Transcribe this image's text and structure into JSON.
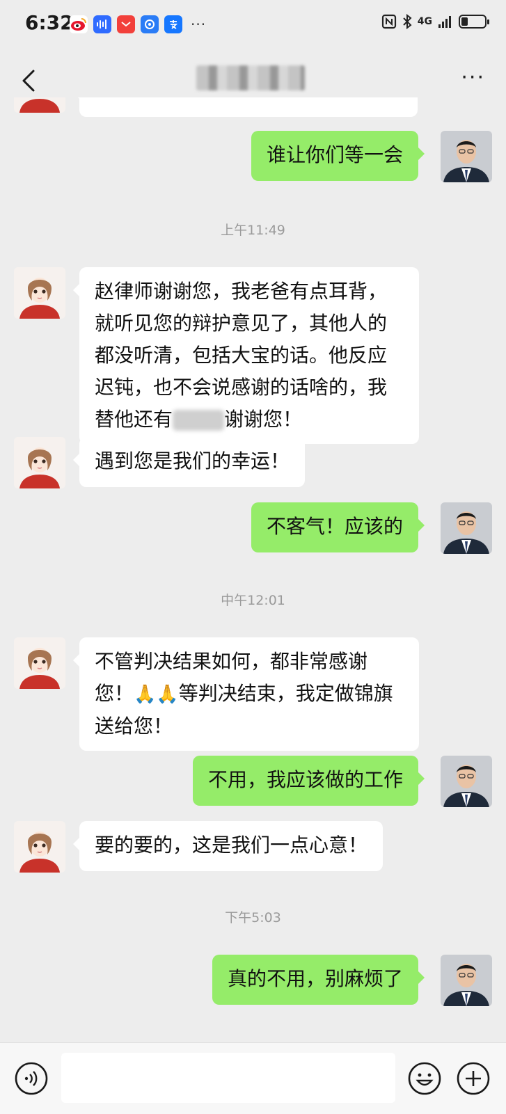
{
  "status_bar": {
    "time": "6:32",
    "network": "4G",
    "icons": [
      "weibo-icon",
      "voice-app-icon",
      "red-app-icon",
      "blue-app-icon",
      "alipay-icon",
      "more-dots-icon",
      "nfc-icon",
      "bluetooth-icon",
      "signal-icon",
      "battery-icon"
    ],
    "battery_level": 0.3
  },
  "header": {
    "back_icon": "chevron-left-icon",
    "more_label": "···"
  },
  "timestamps": {
    "t1": "上午11:49",
    "t2": "中午12:01",
    "t3": "下午5:03"
  },
  "messages": {
    "m1": "谁让你们等一会",
    "m2": "赵律师谢谢您，我老爸有点耳背，就听见您的辩护意见了，其他人的都没听清，包括大宝的话。他反应迟钝，也不会说感谢的话啥的，我替他还有",
    "m2_tail": "谢谢您！",
    "m3": "遇到您是我们的幸运！",
    "m4": "不客气！应该的",
    "m5_a": "不管判决结果如何，都非常感谢您！",
    "m5_emoji": "🙏🙏",
    "m5_b": "等判决结束，我定做锦旗送给您！",
    "m6": "不用，我应该做的工作",
    "m7": "要的要的，这是我们一点心意！",
    "m8": "真的不用，别麻烦了"
  },
  "input_bar": {
    "placeholder": "",
    "icons": [
      "voice-icon",
      "emoji-icon",
      "plus-icon"
    ]
  },
  "colors": {
    "background": "#ededed",
    "outgoing_bubble": "#95ec69",
    "incoming_bubble": "#ffffff",
    "timestamp": "#9a9a9a"
  }
}
